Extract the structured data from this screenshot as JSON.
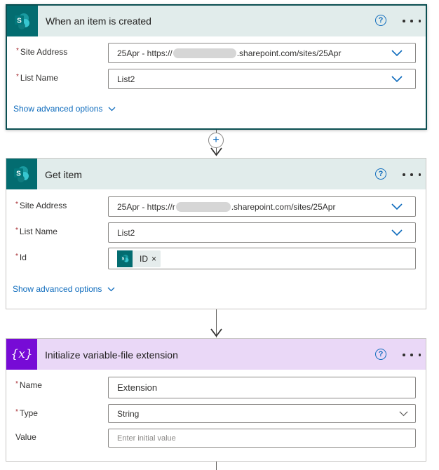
{
  "trigger": {
    "title": "When an item is created",
    "help_icon": "?",
    "fields": {
      "site_address_label": "Site Address",
      "site_address_prefix": "25Apr - https://",
      "site_address_suffix": ".sharepoint.com/sites/25Apr",
      "list_name_label": "List Name",
      "list_name_value": "List2"
    },
    "advanced_label": "Show advanced options"
  },
  "get_item": {
    "title": "Get item",
    "help_icon": "?",
    "fields": {
      "site_address_label": "Site Address",
      "site_address_prefix": "25Apr - https://r",
      "site_address_suffix": ".sharepoint.com/sites/25Apr",
      "list_name_label": "List Name",
      "list_name_value": "List2",
      "id_label": "Id",
      "id_token": "ID",
      "token_close": "×"
    },
    "advanced_label": "Show advanced options"
  },
  "init_variable": {
    "title": "Initialize variable-file extension",
    "help_icon": "?",
    "icon_text": "{x}",
    "fields": {
      "name_label": "Name",
      "name_value": "Extension",
      "type_label": "Type",
      "type_value": "String",
      "value_label": "Value",
      "value_placeholder": "Enter initial value"
    }
  },
  "required_mark": "*",
  "colors": {
    "sharepoint_header": "#e1eceb",
    "variable_header": "#ead8f7",
    "variable_icon": "#770bd6",
    "sharepoint_icon": "#036c70",
    "link": "#0f6cbd"
  }
}
